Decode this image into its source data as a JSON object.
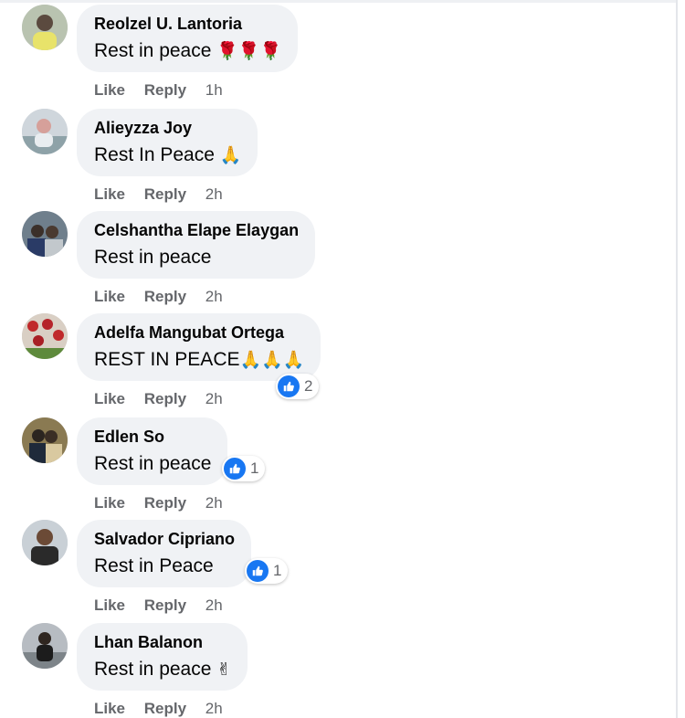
{
  "actions": {
    "like": "Like",
    "reply": "Reply"
  },
  "colors": {
    "bubble": "#f0f2f5",
    "meta": "#65676b",
    "like_blue": "#1877f2"
  },
  "comments": [
    {
      "author": "Reolzel U. Lantoria",
      "text": "Rest in peace",
      "emoji": "🌹🌹🌹",
      "time": "1h",
      "avatar_icon": "avatar-icon"
    },
    {
      "author": "Alieyzza Joy",
      "text": "Rest In Peace",
      "emoji": "🙏",
      "time": "2h",
      "avatar_icon": "avatar-icon"
    },
    {
      "author": "Celshantha Elape Elaygan",
      "text": "Rest in peace",
      "emoji": "",
      "time": "2h",
      "avatar_icon": "avatar-icon"
    },
    {
      "author": "Adelfa Mangubat Ortega",
      "text": "REST IN PEACE",
      "emoji": "🙏🙏🙏",
      "time": "2h",
      "reactions": "2",
      "reaction_icon": "like-icon"
    },
    {
      "author": "Edlen So",
      "text": "Rest in peace",
      "emoji": "",
      "time": "2h",
      "reactions": "1",
      "reaction_icon": "like-icon"
    },
    {
      "author": "Salvador Cipriano",
      "text": "Rest in Peace",
      "emoji": "",
      "time": "2h",
      "reactions": "1",
      "reaction_icon": "like-icon"
    },
    {
      "author": "Lhan Balanon",
      "text": "Rest in peace",
      "emoji": "✌",
      "time": "2h"
    }
  ]
}
